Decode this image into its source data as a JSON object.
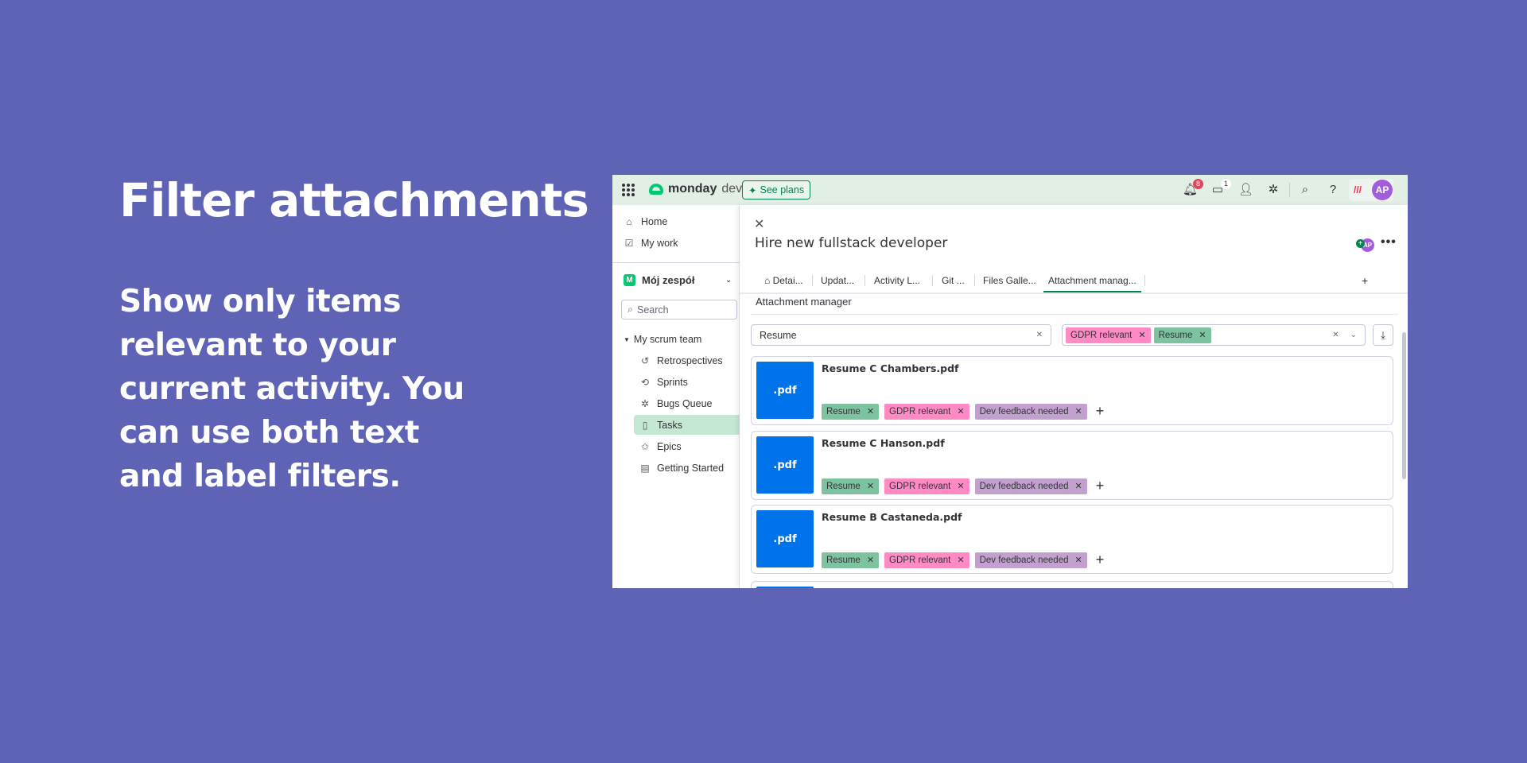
{
  "hero": {
    "title": "Filter attachments",
    "body": "Show only items relevant to your current activity. You can use both text and label filters."
  },
  "topbar": {
    "brand": "monday",
    "brand_suffix": "dev",
    "see_plans": "See plans",
    "notifications_count": "8",
    "inbox_count": "1",
    "avatar": "AP"
  },
  "sidebar": {
    "home": "Home",
    "my_work": "My work",
    "workspace_initial": "M",
    "workspace": "Mój zespół",
    "search_placeholder": "Search",
    "folder": "My scrum team",
    "items": [
      {
        "label": "Retrospectives",
        "icon": "history-icon"
      },
      {
        "label": "Sprints",
        "icon": "sprint-icon"
      },
      {
        "label": "Bugs Queue",
        "icon": "bug-icon"
      },
      {
        "label": "Tasks",
        "icon": "board-icon",
        "active": true
      },
      {
        "label": "Epics",
        "icon": "epic-icon"
      },
      {
        "label": "Getting Started",
        "icon": "doc-icon"
      }
    ]
  },
  "item": {
    "title": "Hire new fullstack developer",
    "avatar": "AP",
    "tabs": [
      {
        "label": "Detai..."
      },
      {
        "label": "Updat..."
      },
      {
        "label": "Activity L..."
      },
      {
        "label": "Git ..."
      },
      {
        "label": "Files Galle..."
      },
      {
        "label": "Attachment manag...",
        "active": true
      }
    ],
    "add_tab": "+"
  },
  "manager": {
    "heading": "Attachment manager",
    "text_filter": "Resume",
    "label_filters": [
      {
        "label": "GDPR relevant",
        "color": "#ff8ac4"
      },
      {
        "label": "Resume",
        "color": "#7ec3a0"
      }
    ],
    "files": [
      {
        "name": "Resume C Chambers.pdf",
        "ext": ".pdf",
        "tags": [
          {
            "label": "Resume",
            "color": "#7ec3a0"
          },
          {
            "label": "GDPR relevant",
            "color": "#ff8ac4"
          },
          {
            "label": "Dev feedback needed",
            "color": "#c3a1cf"
          }
        ]
      },
      {
        "name": "Resume C Hanson.pdf",
        "ext": ".pdf",
        "tags": [
          {
            "label": "Resume",
            "color": "#7ec3a0"
          },
          {
            "label": "GDPR relevant",
            "color": "#ff8ac4"
          },
          {
            "label": "Dev feedback needed",
            "color": "#c3a1cf"
          }
        ]
      },
      {
        "name": "Resume B Castaneda.pdf",
        "ext": ".pdf",
        "tags": [
          {
            "label": "Resume",
            "color": "#7ec3a0"
          },
          {
            "label": "GDPR relevant",
            "color": "#ff8ac4"
          },
          {
            "label": "Dev feedback needed",
            "color": "#c3a1cf"
          }
        ]
      }
    ]
  }
}
